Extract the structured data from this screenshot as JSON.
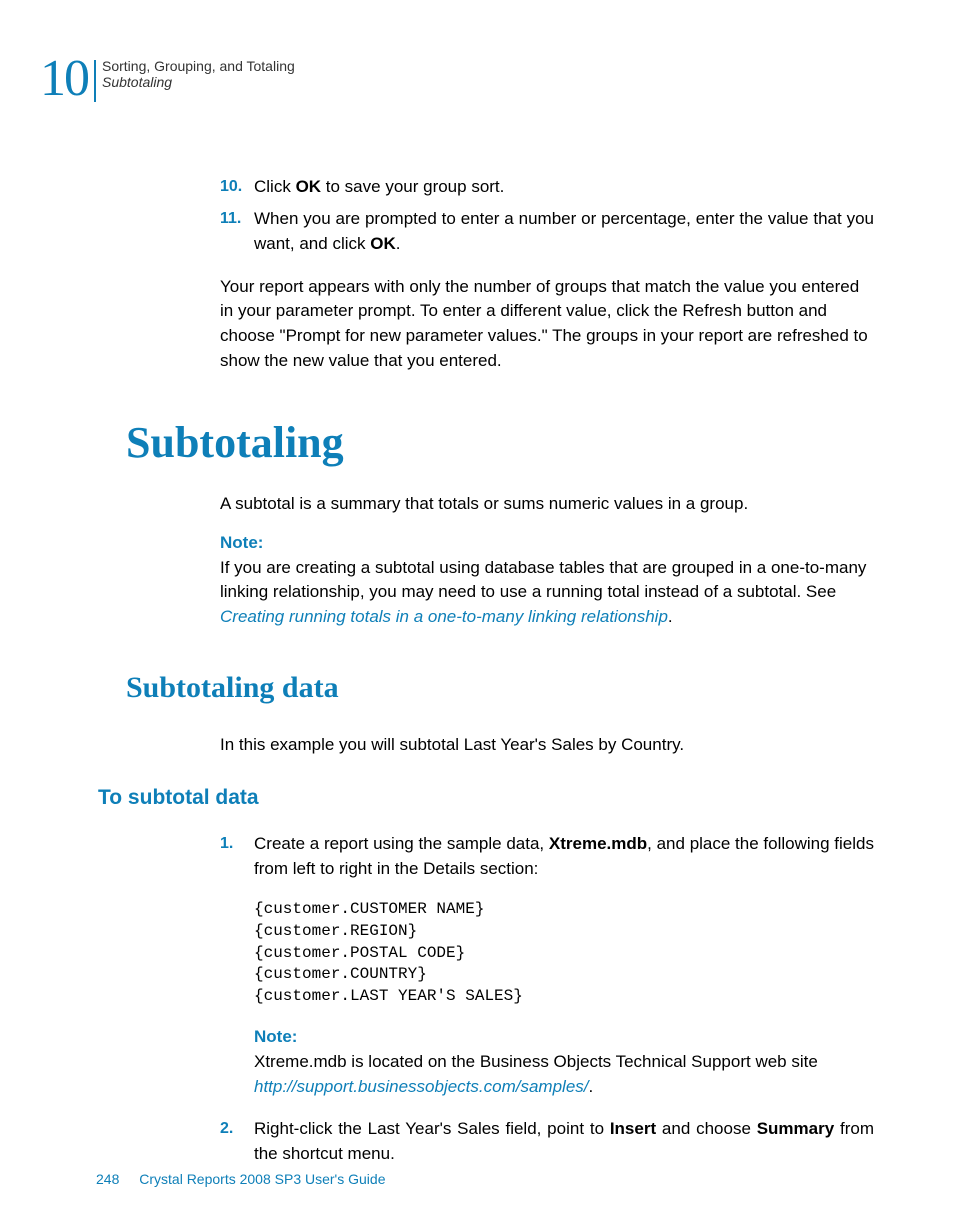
{
  "header": {
    "chapter_number": "10",
    "title": "Sorting, Grouping, and Totaling",
    "subtitle": "Subtotaling"
  },
  "steps_a": [
    {
      "num": "10.",
      "parts": [
        "Click ",
        "OK",
        " to save your group sort."
      ]
    },
    {
      "num": "11.",
      "parts": [
        "When you are prompted to enter a number or percentage, enter the value that you want, and click ",
        "OK",
        "."
      ]
    }
  ],
  "after_steps_para": "Your report appears with only the number of groups that match the value you entered in your parameter prompt. To enter a different value, click the Refresh button and choose \"Prompt for new parameter values.\" The groups in your report are refreshed to show the new value that you entered.",
  "h1": "Subtotaling",
  "intro_para": "A subtotal is a summary that totals or sums numeric values in a group.",
  "note1": {
    "label": "Note:",
    "text_before": "If you are creating a subtotal using database tables that are grouped in a one-to-many linking relationship, you may need to use a running total instead of a subtotal. See ",
    "link": "Creating running totals in a one-to-many linking relationship",
    "text_after": "."
  },
  "h2": "Subtotaling data",
  "h2_para": "In this example you will subtotal Last Year's Sales by Country.",
  "h3": "To subtotal data",
  "steps_b": {
    "1": {
      "num": "1.",
      "parts": [
        "Create a report using the sample data, ",
        "Xtreme.mdb",
        ", and place the following fields from left to right in the Details section:"
      ]
    },
    "code": "{customer.CUSTOMER NAME}\n{customer.REGION}\n{customer.POSTAL CODE}\n{customer.COUNTRY}\n{customer.LAST YEAR'S SALES}",
    "note": {
      "label": "Note:",
      "text_before": "Xtreme.mdb is located on the Business Objects Technical Support web site ",
      "link": "http://support.businessobjects.com/samples/",
      "text_after": "."
    },
    "2": {
      "num": "2.",
      "parts": [
        "Right-click the Last Year's Sales field, point to ",
        "Insert",
        " and choose ",
        "Summary",
        " from the shortcut menu."
      ]
    }
  },
  "footer": {
    "page": "248",
    "doc": "Crystal Reports 2008 SP3 User's Guide"
  }
}
